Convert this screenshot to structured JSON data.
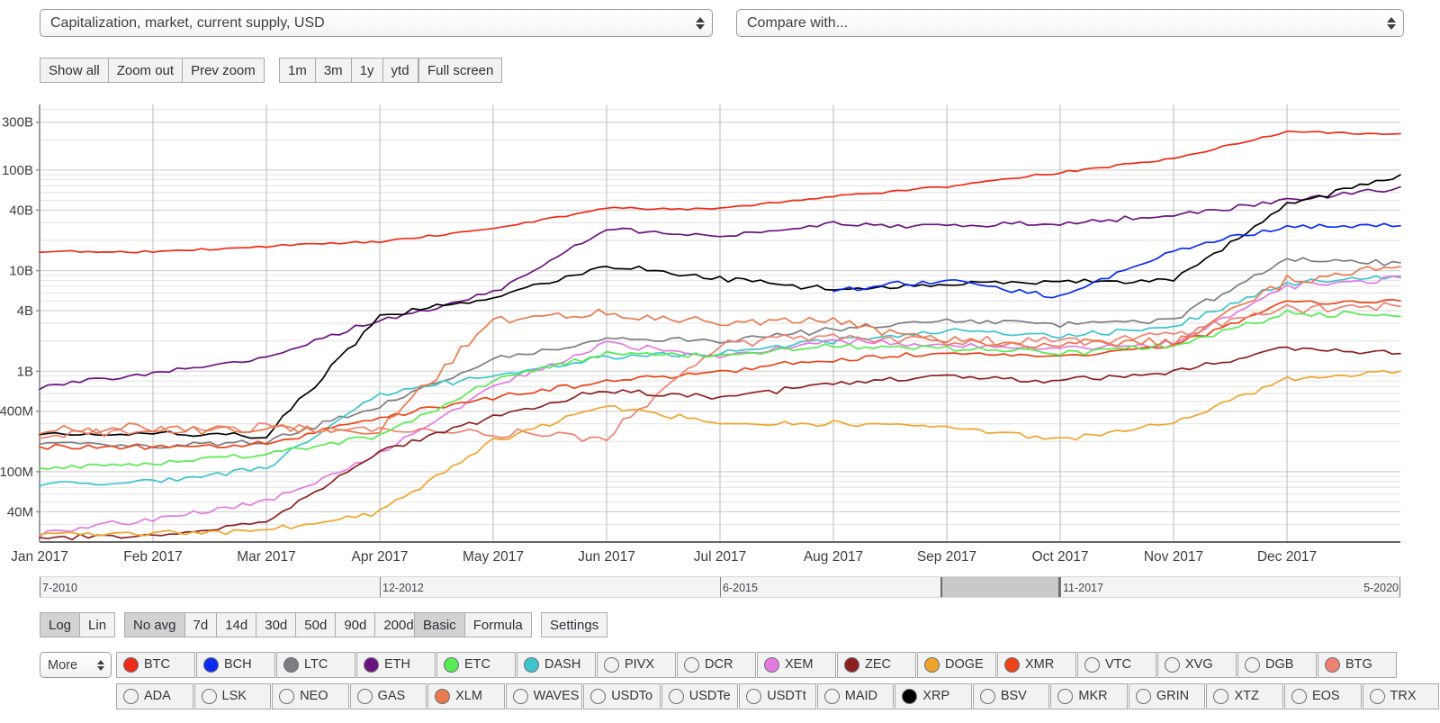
{
  "selects": {
    "metric": {
      "value": "Capitalization, market, current supply, USD"
    },
    "compare": {
      "value": "Compare with..."
    }
  },
  "toolbar": {
    "zoom_group": [
      "Show all",
      "Zoom out",
      "Prev zoom"
    ],
    "range_group": [
      "1m",
      "3m",
      "1y",
      "ytd"
    ],
    "fullscreen": "Full screen"
  },
  "options": {
    "scale": {
      "items": [
        "Log",
        "Lin"
      ],
      "selected": "Log"
    },
    "average": {
      "items": [
        "No avg",
        "7d",
        "14d",
        "30d",
        "50d",
        "90d",
        "200d"
      ],
      "selected": "No avg"
    },
    "mode": {
      "items": [
        "Basic",
        "Formula"
      ],
      "selected": "Basic"
    },
    "settings": "Settings"
  },
  "navigator": {
    "ticks": [
      "7-2010",
      "12-2012",
      "6-2015",
      "11-2017",
      "5-2020"
    ],
    "selection_start_pct": 66.2,
    "selection_end_pct": 75.0
  },
  "coins": {
    "more_label": "More",
    "row1": [
      {
        "sym": "BTC",
        "color": "#ee2b16",
        "on": true
      },
      {
        "sym": "BCH",
        "color": "#0a2bf0",
        "on": true
      },
      {
        "sym": "LTC",
        "color": "#7d7d83",
        "on": true
      },
      {
        "sym": "ETH",
        "color": "#6b1480",
        "on": true
      },
      {
        "sym": "ETC",
        "color": "#56ec52",
        "on": true
      },
      {
        "sym": "DASH",
        "color": "#3ec5cd",
        "on": true
      },
      {
        "sym": "PIVX",
        "color": "",
        "on": false
      },
      {
        "sym": "DCR",
        "color": "",
        "on": false
      },
      {
        "sym": "XEM",
        "color": "#e27ae0",
        "on": true
      },
      {
        "sym": "ZEC",
        "color": "#8c2020",
        "on": true
      },
      {
        "sym": "DOGE",
        "color": "#f0a42c",
        "on": true
      },
      {
        "sym": "XMR",
        "color": "#ec4318",
        "on": true
      },
      {
        "sym": "VTC",
        "color": "",
        "on": false
      },
      {
        "sym": "XVG",
        "color": "",
        "on": false
      },
      {
        "sym": "DGB",
        "color": "",
        "on": false
      },
      {
        "sym": "BTG",
        "color": "#f08070",
        "on": true
      }
    ],
    "row2": [
      {
        "sym": "ADA",
        "color": "",
        "on": false
      },
      {
        "sym": "LSK",
        "color": "",
        "on": false
      },
      {
        "sym": "NEO",
        "color": "",
        "on": false
      },
      {
        "sym": "GAS",
        "color": "",
        "on": false
      },
      {
        "sym": "XLM",
        "color": "#e87a4c",
        "on": true
      },
      {
        "sym": "WAVES",
        "color": "",
        "on": false
      },
      {
        "sym": "USDTo",
        "color": "",
        "on": false
      },
      {
        "sym": "USDTe",
        "color": "",
        "on": false
      },
      {
        "sym": "USDTt",
        "color": "",
        "on": false
      },
      {
        "sym": "MAID",
        "color": "",
        "on": false
      },
      {
        "sym": "XRP",
        "color": "#000000",
        "on": true
      },
      {
        "sym": "BSV",
        "color": "",
        "on": false
      },
      {
        "sym": "MKR",
        "color": "",
        "on": false
      },
      {
        "sym": "GRIN",
        "color": "",
        "on": false
      },
      {
        "sym": "XTZ",
        "color": "",
        "on": false
      },
      {
        "sym": "EOS",
        "color": "",
        "on": false
      },
      {
        "sym": "TRX",
        "color": "",
        "on": false
      }
    ]
  },
  "chart_data": {
    "type": "line",
    "title": "",
    "xlabel": "",
    "ylabel": "Capitalization, market, current supply, USD",
    "log_scale": true,
    "grid": true,
    "legend_position": "bottom",
    "ytick_labels": [
      "300B",
      "100B",
      "40B",
      "10B",
      "4B",
      "1B",
      "400M",
      "100M",
      "40M"
    ],
    "ytick_values": [
      300000000000,
      100000000000,
      40000000000,
      10000000000,
      4000000000,
      1000000000,
      400000000,
      100000000,
      40000000
    ],
    "ylim": [
      20000000,
      450000000000
    ],
    "xtick_labels": [
      "Jan 2017",
      "Feb 2017",
      "Mar 2017",
      "Apr 2017",
      "May 2017",
      "Jun 2017",
      "Jul 2017",
      "Aug 2017",
      "Sep 2017",
      "Oct 2017",
      "Nov 2017",
      "Dec 2017"
    ],
    "x": [
      "2017-01",
      "2017-02",
      "2017-03",
      "2017-04",
      "2017-05",
      "2017-06",
      "2017-07",
      "2017-08",
      "2017-09",
      "2017-10",
      "2017-11",
      "2017-12",
      "2017-12-31"
    ],
    "series": [
      {
        "name": "BTC",
        "color": "#ee2b16",
        "values": [
          15500000000.0,
          15500000000.0,
          17500000000.0,
          19500000000.0,
          26000000000.0,
          42000000000.0,
          41000000000.0,
          55000000000.0,
          68000000000.0,
          95000000000.0,
          130000000000.0,
          240000000000.0,
          230000000000.0
        ]
      },
      {
        "name": "ETH",
        "color": "#6b1480",
        "values": [
          700000000.0,
          950000000.0,
          1350000000.0,
          3200000000.0,
          6000000000.0,
          25000000000.0,
          22000000000.0,
          29000000000.0,
          28000000000.0,
          29000000000.0,
          35000000000.0,
          50000000000.0,
          68000000000.0
        ]
      },
      {
        "name": "XRP",
        "color": "#000000",
        "values": [
          240000000.0,
          240000000.0,
          230000000.0,
          3500000000.0,
          5500000000.0,
          11000000000.0,
          8500000000.0,
          6500000000.0,
          7200000000.0,
          7800000000.0,
          8000000000.0,
          45000000000.0,
          90000000000.0
        ]
      },
      {
        "name": "BCH",
        "color": "#0a2bf0",
        "values": [
          null,
          null,
          null,
          null,
          null,
          null,
          null,
          6500000000.0,
          8000000000.0,
          5500000000.0,
          16000000000.0,
          28000000000.0,
          28000000000.0
        ]
      },
      {
        "name": "LTC",
        "color": "#7d7d83",
        "values": [
          190000000.0,
          180000000.0,
          200000000.0,
          450000000.0,
          1300000000.0,
          2100000000.0,
          2000000000.0,
          2600000000.0,
          3200000000.0,
          2900000000.0,
          3300000000.0,
          13000000000.0,
          12000000000.0
        ]
      },
      {
        "name": "DASH",
        "color": "#3ec5cd",
        "values": [
          75000000.0,
          80000000.0,
          110000000.0,
          600000000.0,
          900000000.0,
          1400000000.0,
          1500000000.0,
          2000000000.0,
          2600000000.0,
          2200000000.0,
          2800000000.0,
          7500000000.0,
          8800000000.0
        ]
      },
      {
        "name": "XEM",
        "color": "#e27ae0",
        "values": [
          24000000.0,
          34000000.0,
          50000000.0,
          150000000.0,
          700000000.0,
          1900000000.0,
          1400000000.0,
          2000000000.0,
          1800000000.0,
          1700000000.0,
          1900000000.0,
          7000000000.0,
          8500000000.0
        ]
      },
      {
        "name": "XMR",
        "color": "#ec4318",
        "values": [
          180000000.0,
          175000000.0,
          190000000.0,
          350000000.0,
          550000000.0,
          800000000.0,
          1000000000.0,
          1300000000.0,
          1500000000.0,
          1400000000.0,
          1800000000.0,
          4800000000.0,
          5000000000.0
        ]
      },
      {
        "name": "BTG",
        "color": "#f08070",
        "values": [
          230000000.0,
          260000000.0,
          270000000.0,
          260000000.0,
          240000000.0,
          220000000.0,
          1900000000.0,
          2200000000.0,
          2000000000.0,
          1900000000.0,
          2300000000.0,
          4200000000.0,
          4400000000.0
        ]
      },
      {
        "name": "ETC",
        "color": "#56ec52",
        "values": [
          110000000.0,
          120000000.0,
          150000000.0,
          230000000.0,
          800000000.0,
          1500000000.0,
          1400000000.0,
          1800000000.0,
          1700000000.0,
          1500000000.0,
          1800000000.0,
          3800000000.0,
          3500000000.0
        ]
      },
      {
        "name": "XLM",
        "color": "#e87a4c",
        "values": [
          250000000.0,
          270000000.0,
          260000000.0,
          260000000.0,
          3200000000.0,
          3800000000.0,
          3000000000.0,
          3100000000.0,
          2000000000.0,
          1800000000.0,
          2000000000.0,
          8000000000.0,
          11000000000.0
        ]
      },
      {
        "name": "ZEC",
        "color": "#8c2020",
        "values": [
          22000000.0,
          23000000.0,
          32000000.0,
          160000000.0,
          350000000.0,
          650000000.0,
          550000000.0,
          750000000.0,
          900000000.0,
          800000000.0,
          1000000000.0,
          1700000000.0,
          1500000000.0
        ]
      },
      {
        "name": "DOGE",
        "color": "#f0a42c",
        "values": [
          24000000.0,
          24000000.0,
          26000000.0,
          40000000.0,
          200000000.0,
          450000000.0,
          300000000.0,
          300000000.0,
          280000000.0,
          210000000.0,
          300000000.0,
          850000000.0,
          1000000000.0
        ]
      }
    ]
  }
}
